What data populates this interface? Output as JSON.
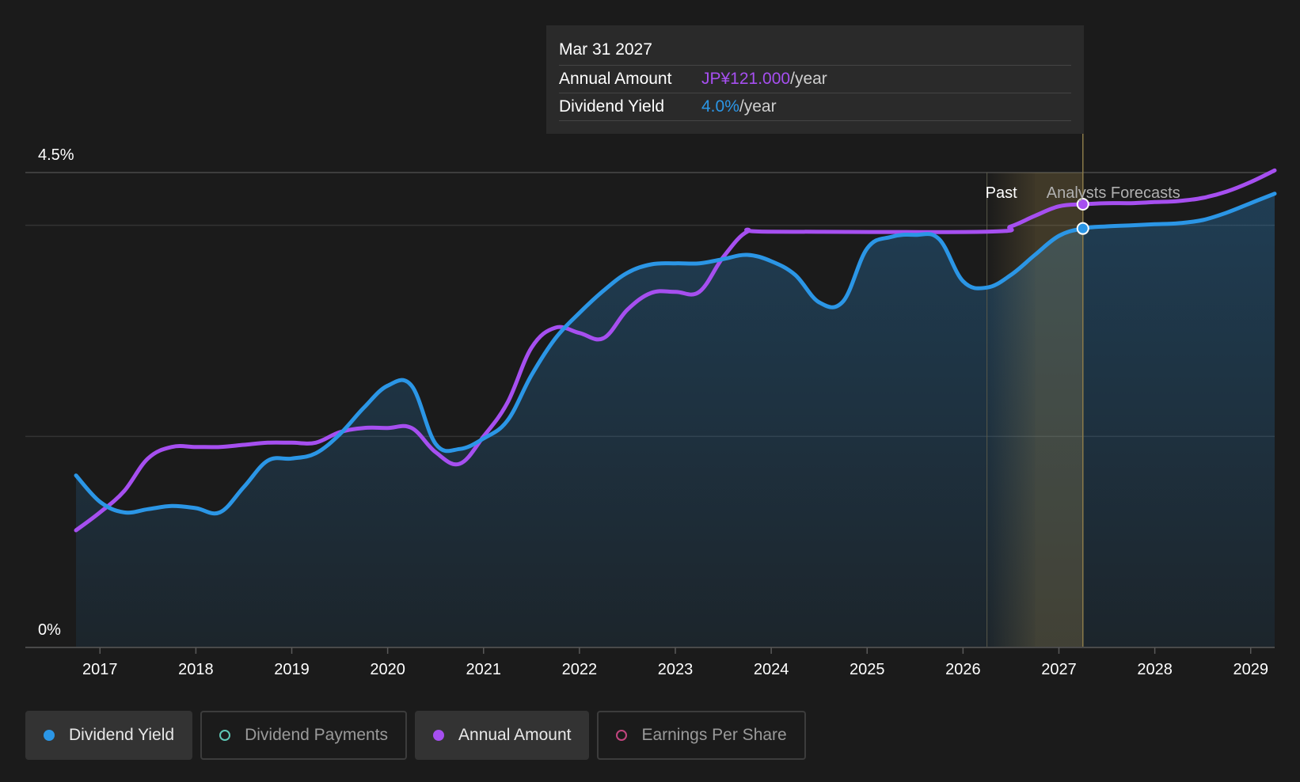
{
  "tooltip": {
    "date": "Mar 31 2027",
    "annual_label": "Annual Amount",
    "annual_value": "JP¥121.000",
    "annual_unit": "/year",
    "yield_label": "Dividend Yield",
    "yield_value": "4.0%",
    "yield_unit": "/year"
  },
  "regions": {
    "past_label": "Past",
    "forecast_label": "Analysts Forecasts"
  },
  "legend": [
    {
      "label": "Dividend Yield",
      "color": "#2b96e6",
      "active": true
    },
    {
      "label": "Dividend Payments",
      "color": "#5ec7b5",
      "active": false
    },
    {
      "label": "Annual Amount",
      "color": "#a64ff0",
      "active": true
    },
    {
      "label": "Earnings Per Share",
      "color": "#c2457f",
      "active": false
    }
  ],
  "colors": {
    "background": "#1b1b1b",
    "yield": "#2b96e6",
    "annual": "#a64ff0",
    "forecast_band": "#d8b460"
  },
  "chart_data": {
    "type": "line",
    "xlim": [
      2016.75,
      2029.25
    ],
    "ylim": [
      0,
      4.5
    ],
    "x_ticks": [
      2017,
      2018,
      2019,
      2020,
      2021,
      2022,
      2023,
      2024,
      2025,
      2026,
      2027,
      2028,
      2029
    ],
    "y_tick_labels": [
      {
        "value": 4.5,
        "label": "4.5%"
      },
      {
        "value": 0,
        "label": "0%"
      }
    ],
    "gridlines": [
      4.5,
      4.0,
      2.0
    ],
    "past_end": 2026.25,
    "forecast_start": 2026.75,
    "tooltip_x": 2027.25,
    "series": [
      {
        "name": "Dividend Yield",
        "key": "yield",
        "fill": true,
        "points": [
          [
            2016.75,
            1.63
          ],
          [
            2017.0,
            1.38
          ],
          [
            2017.25,
            1.28
          ],
          [
            2017.5,
            1.31
          ],
          [
            2017.75,
            1.34
          ],
          [
            2018.0,
            1.32
          ],
          [
            2018.25,
            1.28
          ],
          [
            2018.5,
            1.52
          ],
          [
            2018.75,
            1.77
          ],
          [
            2019.0,
            1.79
          ],
          [
            2019.25,
            1.84
          ],
          [
            2019.5,
            2.02
          ],
          [
            2019.75,
            2.27
          ],
          [
            2020.0,
            2.48
          ],
          [
            2020.25,
            2.48
          ],
          [
            2020.5,
            1.93
          ],
          [
            2020.75,
            1.88
          ],
          [
            2021.0,
            1.98
          ],
          [
            2021.25,
            2.15
          ],
          [
            2021.5,
            2.58
          ],
          [
            2021.75,
            2.93
          ],
          [
            2022.0,
            3.17
          ],
          [
            2022.25,
            3.38
          ],
          [
            2022.5,
            3.55
          ],
          [
            2022.75,
            3.63
          ],
          [
            2023.0,
            3.64
          ],
          [
            2023.25,
            3.64
          ],
          [
            2023.5,
            3.68
          ],
          [
            2023.75,
            3.72
          ],
          [
            2024.0,
            3.66
          ],
          [
            2024.25,
            3.53
          ],
          [
            2024.5,
            3.27
          ],
          [
            2024.75,
            3.28
          ],
          [
            2025.0,
            3.78
          ],
          [
            2025.25,
            3.89
          ],
          [
            2025.5,
            3.91
          ],
          [
            2025.75,
            3.87
          ],
          [
            2026.0,
            3.47
          ],
          [
            2026.25,
            3.41
          ],
          [
            2026.5,
            3.53
          ],
          [
            2026.75,
            3.72
          ],
          [
            2027.0,
            3.9
          ],
          [
            2027.25,
            3.97
          ],
          [
            2027.5,
            3.99
          ],
          [
            2027.75,
            4.0
          ],
          [
            2028.0,
            4.01
          ],
          [
            2028.25,
            4.02
          ],
          [
            2028.5,
            4.05
          ],
          [
            2028.75,
            4.12
          ],
          [
            2029.0,
            4.21
          ],
          [
            2029.25,
            4.3
          ]
        ]
      },
      {
        "name": "Annual Amount",
        "key": "annual",
        "fill": false,
        "points": [
          [
            2016.75,
            1.11
          ],
          [
            2017.0,
            1.28
          ],
          [
            2017.25,
            1.48
          ],
          [
            2017.5,
            1.79
          ],
          [
            2017.75,
            1.9
          ],
          [
            2018.0,
            1.9
          ],
          [
            2018.25,
            1.9
          ],
          [
            2018.5,
            1.92
          ],
          [
            2018.75,
            1.94
          ],
          [
            2019.0,
            1.94
          ],
          [
            2019.25,
            1.94
          ],
          [
            2019.5,
            2.04
          ],
          [
            2019.75,
            2.08
          ],
          [
            2020.0,
            2.08
          ],
          [
            2020.25,
            2.08
          ],
          [
            2020.5,
            1.85
          ],
          [
            2020.75,
            1.74
          ],
          [
            2021.0,
            2.0
          ],
          [
            2021.25,
            2.32
          ],
          [
            2021.5,
            2.84
          ],
          [
            2021.75,
            3.03
          ],
          [
            2022.0,
            2.98
          ],
          [
            2022.25,
            2.93
          ],
          [
            2022.5,
            3.2
          ],
          [
            2022.75,
            3.36
          ],
          [
            2023.0,
            3.37
          ],
          [
            2023.25,
            3.37
          ],
          [
            2023.5,
            3.7
          ],
          [
            2023.75,
            3.94
          ],
          [
            2024.0,
            3.94
          ],
          [
            2026.25,
            3.94
          ],
          [
            2026.5,
            3.99
          ],
          [
            2026.75,
            4.09
          ],
          [
            2027.0,
            4.18
          ],
          [
            2027.25,
            4.2
          ],
          [
            2027.5,
            4.21
          ],
          [
            2027.75,
            4.21
          ],
          [
            2028.0,
            4.22
          ],
          [
            2028.25,
            4.23
          ],
          [
            2028.5,
            4.26
          ],
          [
            2028.75,
            4.32
          ],
          [
            2029.0,
            4.41
          ],
          [
            2029.25,
            4.52
          ]
        ]
      }
    ]
  }
}
